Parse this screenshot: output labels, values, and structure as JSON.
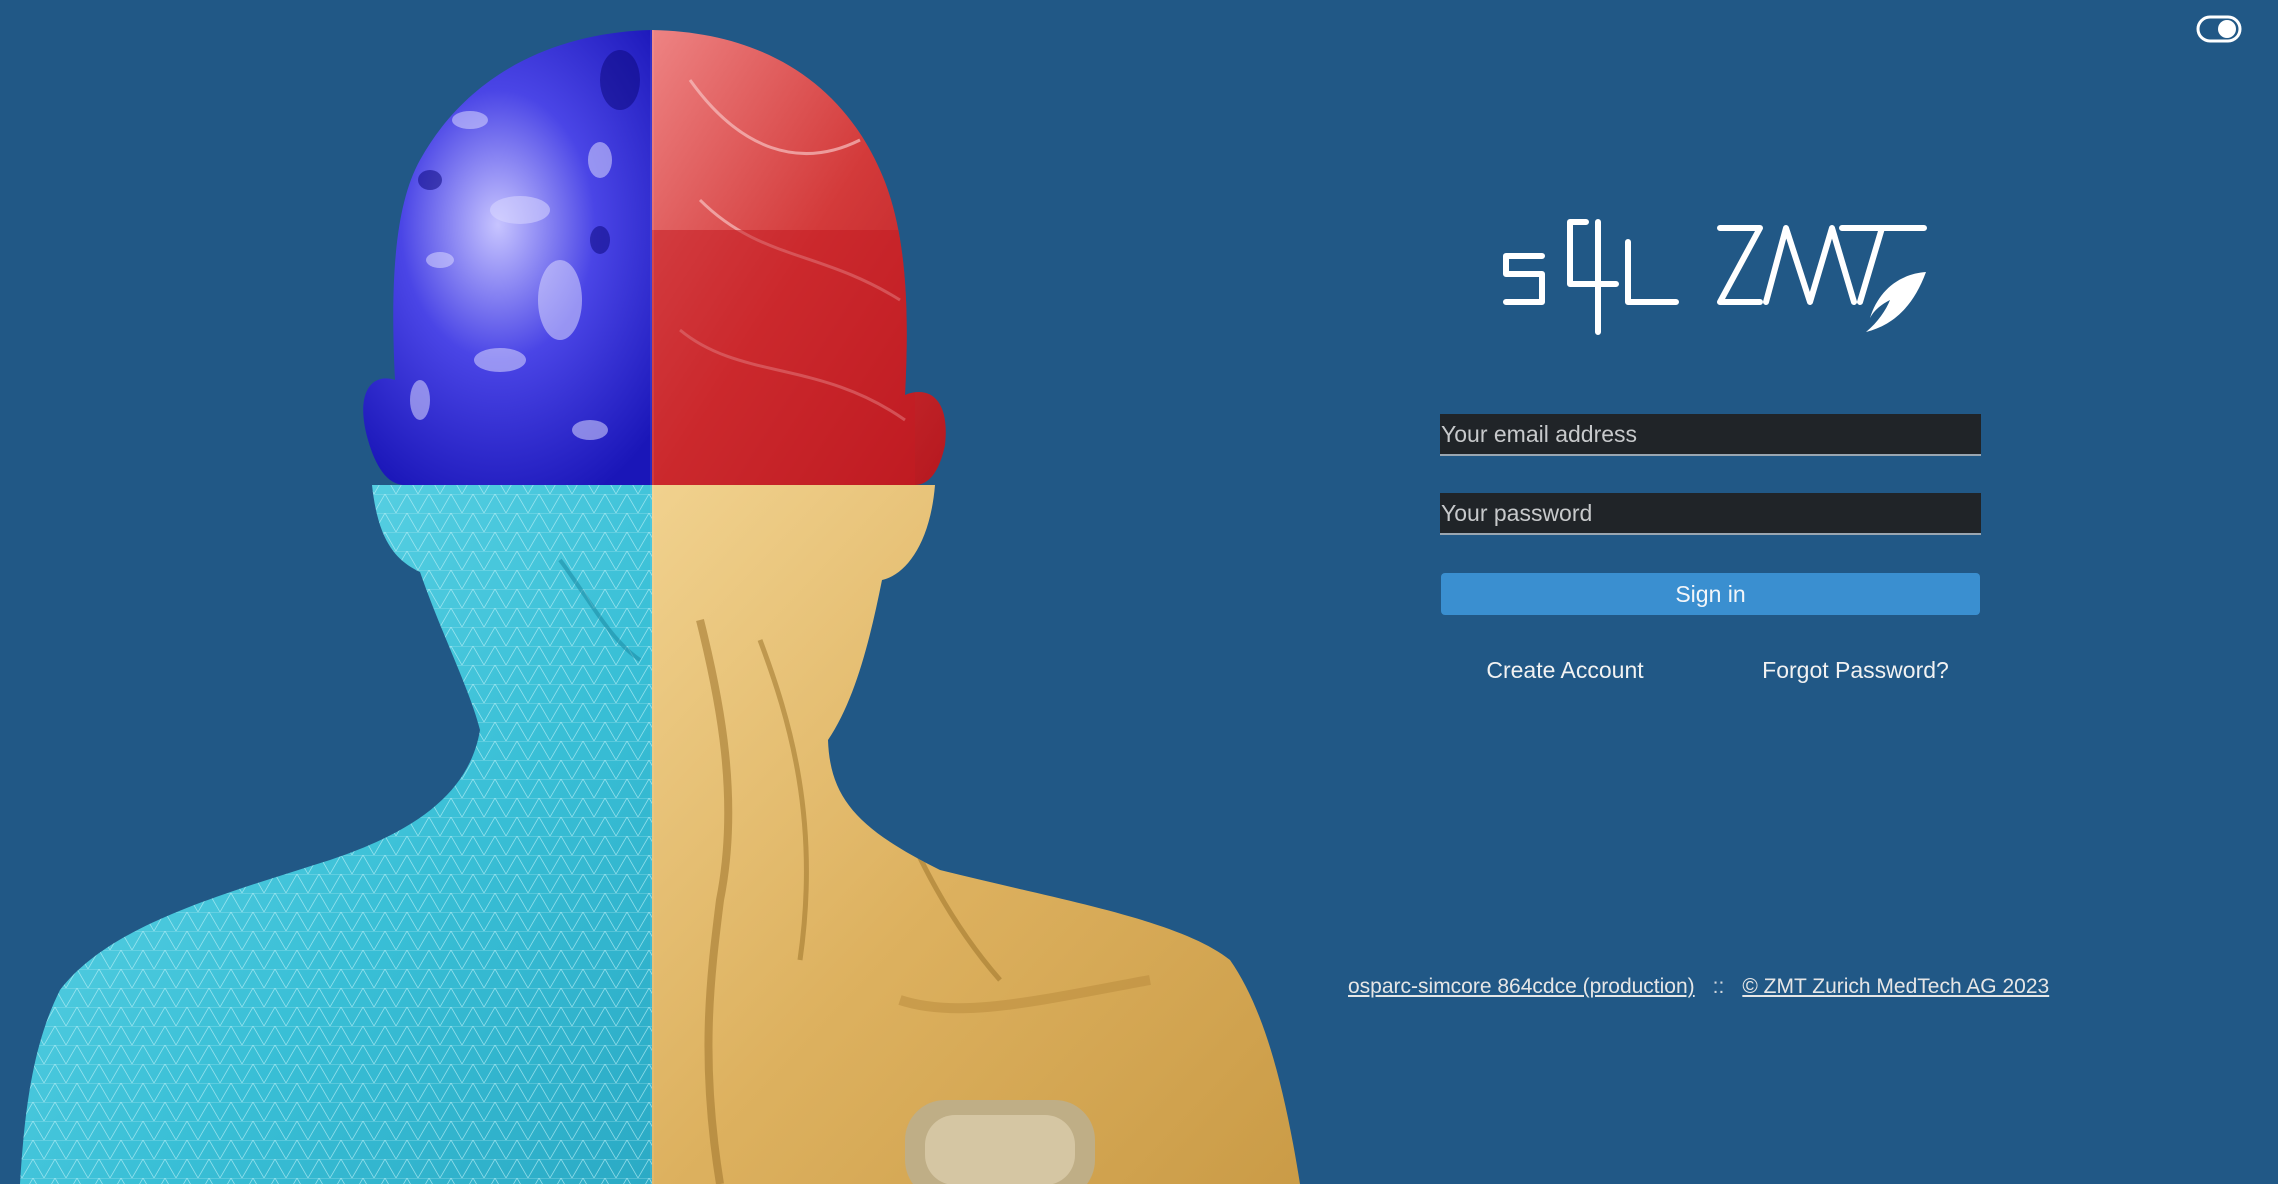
{
  "login": {
    "email_placeholder": "Your email address",
    "password_placeholder": "Your password",
    "signin_label": "Sign in",
    "create_account_label": "Create Account",
    "forgot_password_label": "Forgot Password?"
  },
  "footer": {
    "version_link": "osparc-simcore 864cdce (production)",
    "separator": "::",
    "copyright_link": "© ZMT Zurich MedTech AG 2023"
  },
  "icons": {
    "theme_toggle": "toggle-icon",
    "logo": "s4l-zmt-logo"
  },
  "colors": {
    "background": "#215886",
    "primary_button": "#3a8fd0",
    "input_background": "#202428"
  }
}
